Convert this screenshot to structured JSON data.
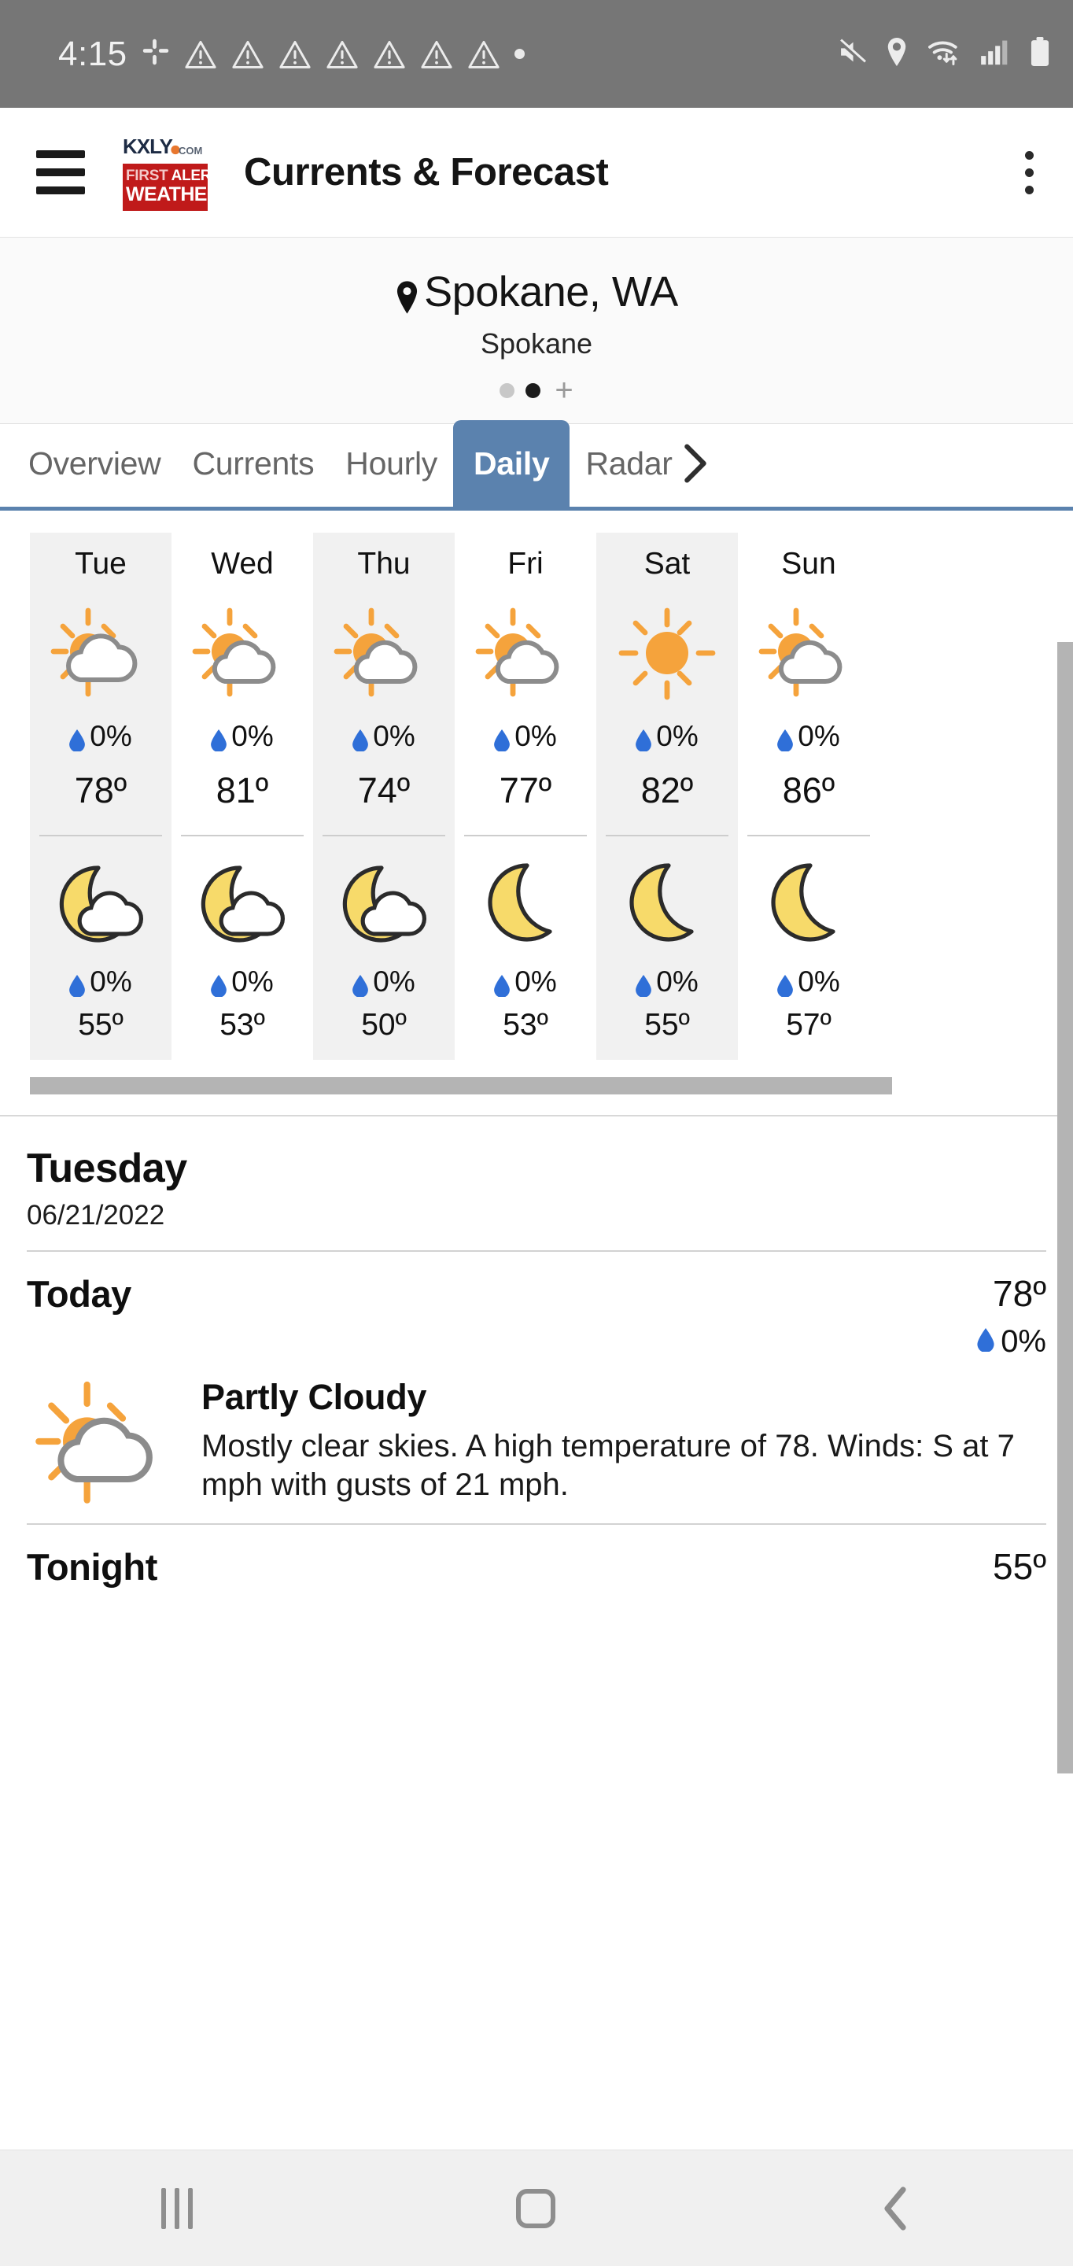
{
  "status_bar": {
    "time": "4:15",
    "icons_left": [
      "slack-icon",
      "warning-triangle-icon",
      "warning-triangle-icon",
      "warning-triangle-icon",
      "warning-triangle-icon",
      "warning-triangle-icon",
      "warning-triangle-icon",
      "warning-triangle-icon",
      "dot-icon"
    ],
    "icons_right": [
      "mute-icon",
      "location-pin-icon",
      "wifi-icon",
      "signal-bars-icon",
      "battery-icon"
    ]
  },
  "app_bar": {
    "menu_icon": "hamburger-menu-icon",
    "logo": {
      "brand": "KXLY",
      "domain": ".COM",
      "line1_a": "FIRST ",
      "line1_b": "ALERT",
      "line2": "WEATHER"
    },
    "title": "Currents & Forecast",
    "overflow_icon": "kebab-menu-icon"
  },
  "location": {
    "pin_icon": "location-pin-icon",
    "city_state": "Spokane, WA",
    "subtitle": "Spokane",
    "pager": {
      "count": 2,
      "active_index": 1,
      "add_label": "+"
    }
  },
  "tabs": {
    "items": [
      {
        "label": "Overview",
        "active": false
      },
      {
        "label": "Currents",
        "active": false
      },
      {
        "label": "Hourly",
        "active": false
      },
      {
        "label": "Daily",
        "active": true
      },
      {
        "label": "Radar",
        "active": false
      }
    ],
    "more_icon": "chevron-right-icon",
    "active_color": "#5b82ae"
  },
  "daily": {
    "days": [
      {
        "name": "Tue",
        "day_icon": "partly-cloudy-icon",
        "day_precip": "0%",
        "high": "78º",
        "night_icon": "partly-cloudy-night-icon",
        "night_precip": "0%",
        "low": "55º",
        "shaded": true
      },
      {
        "name": "Wed",
        "day_icon": "partly-cloudy-icon",
        "day_precip": "0%",
        "high": "81º",
        "night_icon": "partly-cloudy-night-icon",
        "night_precip": "0%",
        "low": "53º",
        "shaded": false
      },
      {
        "name": "Thu",
        "day_icon": "partly-cloudy-icon",
        "day_precip": "0%",
        "high": "74º",
        "night_icon": "partly-cloudy-night-icon",
        "night_precip": "0%",
        "low": "50º",
        "shaded": true
      },
      {
        "name": "Fri",
        "day_icon": "partly-cloudy-icon",
        "day_precip": "0%",
        "high": "77º",
        "night_icon": "clear-night-icon",
        "night_precip": "0%",
        "low": "53º",
        "shaded": false
      },
      {
        "name": "Sat",
        "day_icon": "sunny-icon",
        "day_precip": "0%",
        "high": "82º",
        "night_icon": "clear-night-icon",
        "night_precip": "0%",
        "low": "55º",
        "shaded": true
      },
      {
        "name": "Sun",
        "day_icon": "partly-cloudy-icon",
        "day_precip": "0%",
        "high": "86º",
        "night_icon": "clear-night-icon",
        "night_precip": "0%",
        "low": "57º",
        "shaded": false
      }
    ],
    "drop_icon": "water-drop-icon",
    "scrollbar": "horizontal-scrollbar"
  },
  "detail": {
    "day_name": "Tuesday",
    "date": "06/21/2022",
    "periods": [
      {
        "name": "Today",
        "temp": "78º",
        "precip": "0%",
        "icon": "partly-cloudy-icon",
        "condition": "Partly Cloudy",
        "description": "Mostly clear skies.  A high temperature of 78.  Winds: S at 7 mph with gusts of 21 mph."
      },
      {
        "name": "Tonight",
        "temp": "55º"
      }
    ]
  },
  "nav_bar": {
    "recents_icon": "recents-icon",
    "home_icon": "home-icon",
    "back_icon": "back-icon"
  },
  "colors": {
    "accent": "#5b82ae",
    "sun": "#f5a33c",
    "moon": "#f7da6a",
    "drop": "#2f6fd8",
    "status_bar": "#767676",
    "logo_red": "#c01a1a"
  }
}
